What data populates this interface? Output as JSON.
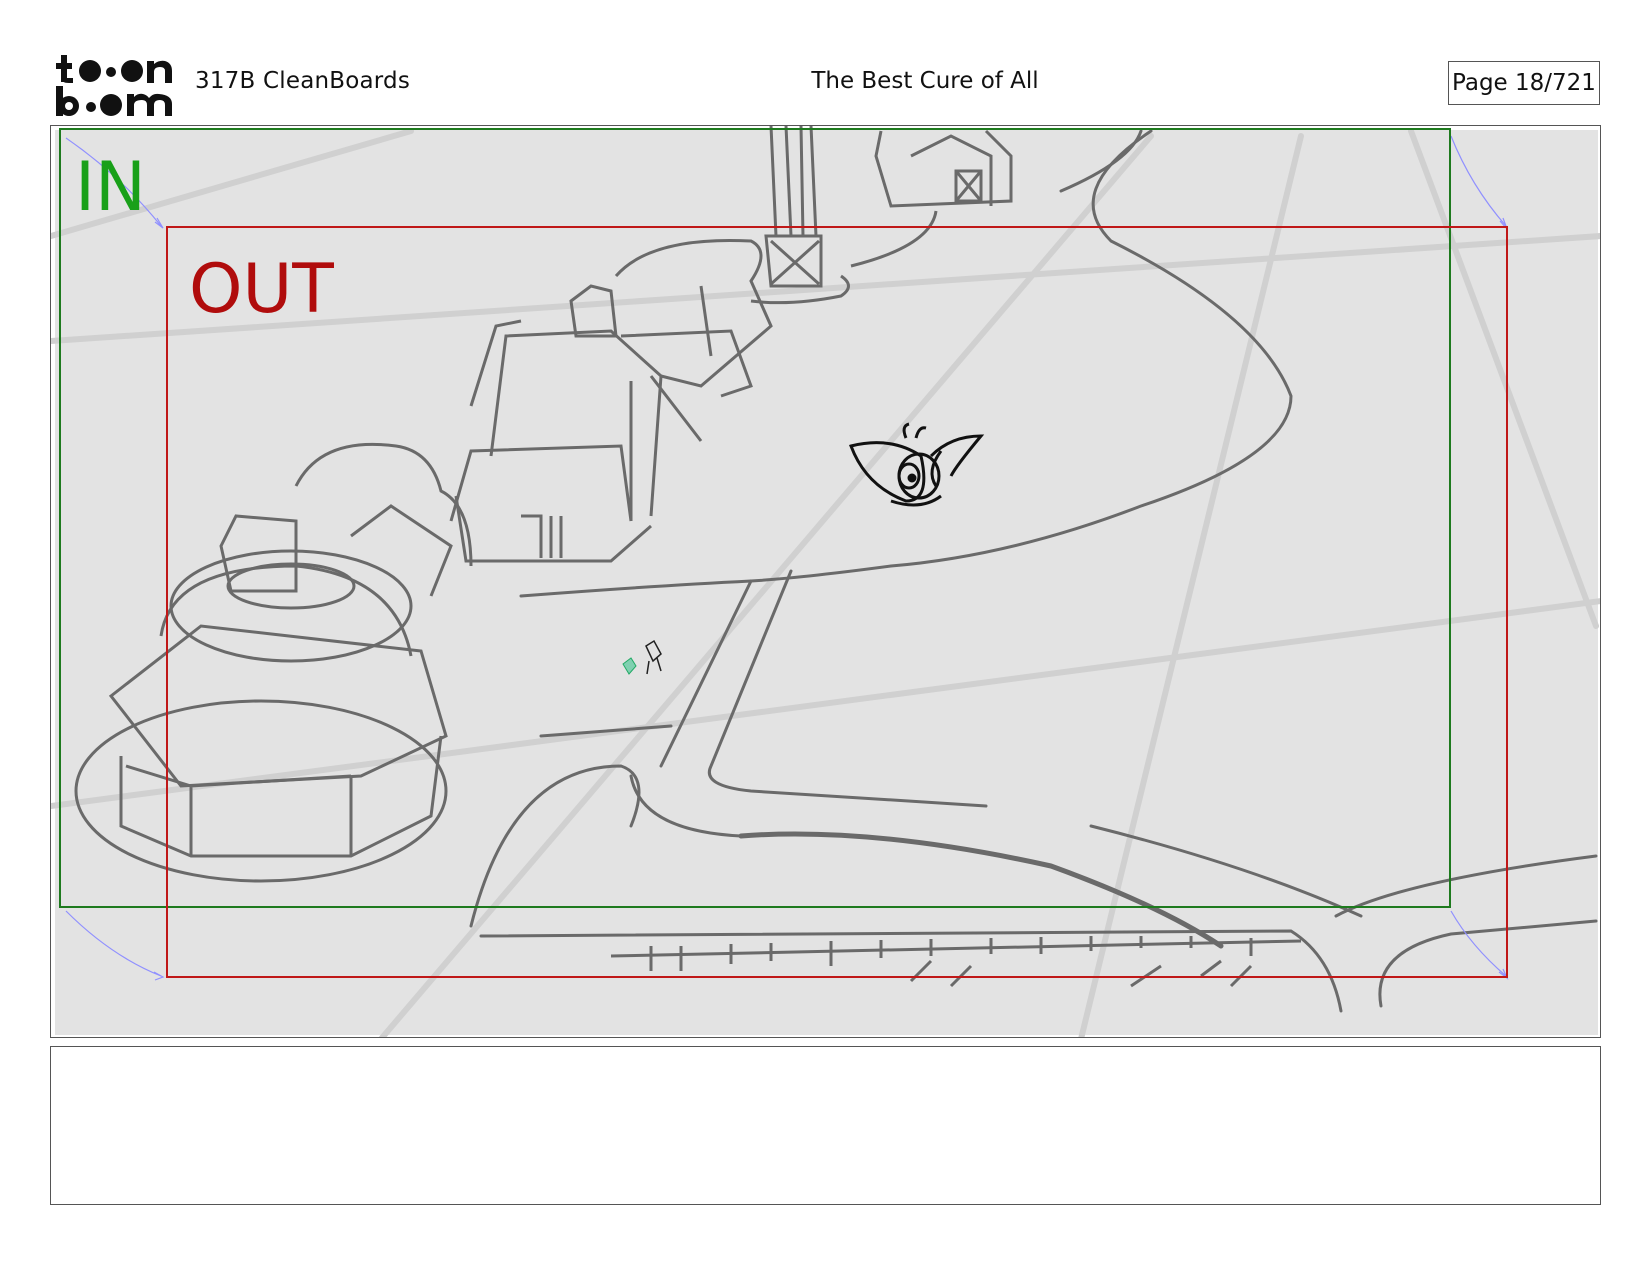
{
  "header": {
    "logo_text": "toon boom",
    "production": "317B  CleanBoards",
    "title": "The Best Cure of All",
    "page_label": "Page  18/721"
  },
  "panel": {
    "in_label": "IN",
    "out_label": "OUT",
    "in_frame_color": "#1e7a1e",
    "out_frame_color": "#c01818",
    "background_color": "#e3e3e3"
  },
  "notes": {
    "text": ""
  }
}
